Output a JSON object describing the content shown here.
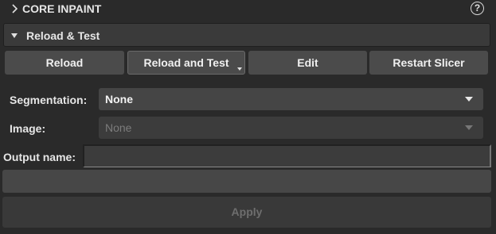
{
  "section": {
    "title": "CORE INPAINT",
    "help_glyph": "?"
  },
  "collapsible": {
    "label": "Reload & Test"
  },
  "buttons": {
    "reload": "Reload",
    "reload_and_test": "Reload and Test",
    "edit": "Edit",
    "restart": "Restart Slicer"
  },
  "form": {
    "segmentation": {
      "label": "Segmentation:",
      "value": "None"
    },
    "image": {
      "label": "Image:",
      "value": "None",
      "enabled": false
    },
    "output_name": {
      "label": "Output name:",
      "value": ""
    }
  },
  "apply": {
    "label": "Apply",
    "enabled": false
  }
}
